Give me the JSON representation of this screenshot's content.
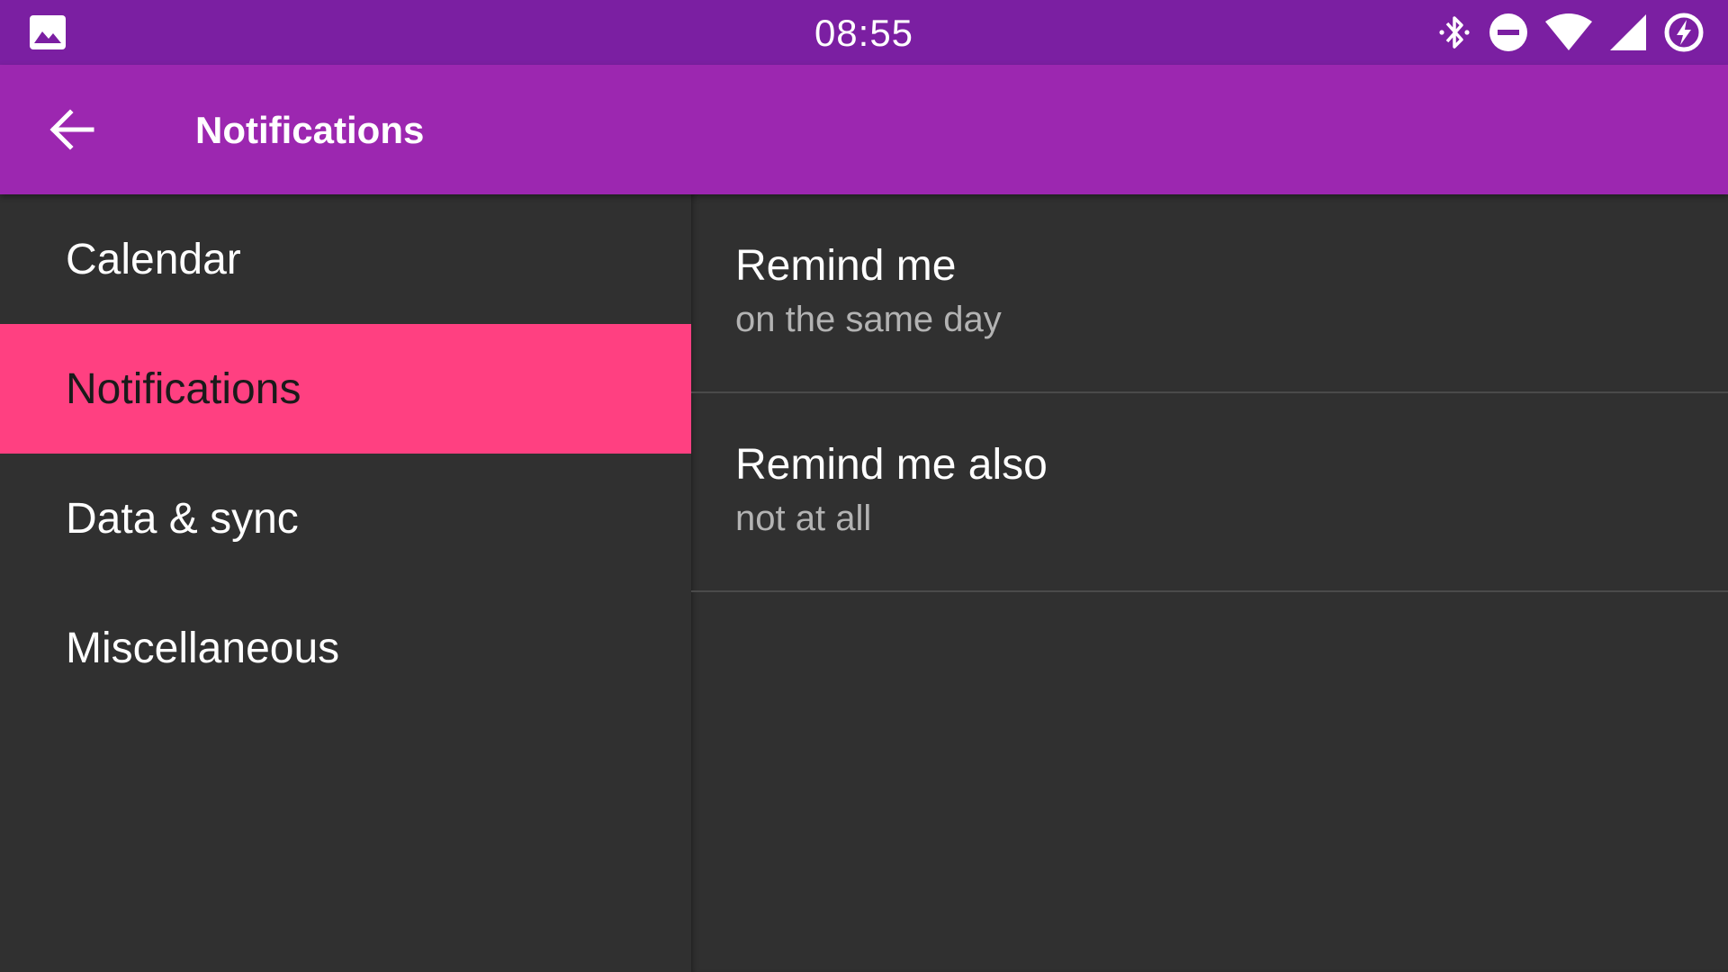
{
  "status_bar": {
    "time": "08:55",
    "icons": [
      "image-icon",
      "bluetooth-icon",
      "do-not-disturb-icon",
      "wifi-icon",
      "cell-signal-icon",
      "battery-saver-icon"
    ]
  },
  "app_bar": {
    "title": "Notifications",
    "back_icon": "arrow-back-icon"
  },
  "categories": [
    {
      "label": "Calendar",
      "selected": false
    },
    {
      "label": "Notifications",
      "selected": true
    },
    {
      "label": "Data & sync",
      "selected": false
    },
    {
      "label": "Miscellaneous",
      "selected": false
    }
  ],
  "preferences": [
    {
      "title": "Remind me",
      "summary": "on the same day"
    },
    {
      "title": "Remind me also",
      "summary": "not at all"
    }
  ],
  "colors": {
    "status_bar": "#7B1FA2",
    "primary": "#9C27B0",
    "accent": "#FF4081",
    "background": "#303030"
  }
}
